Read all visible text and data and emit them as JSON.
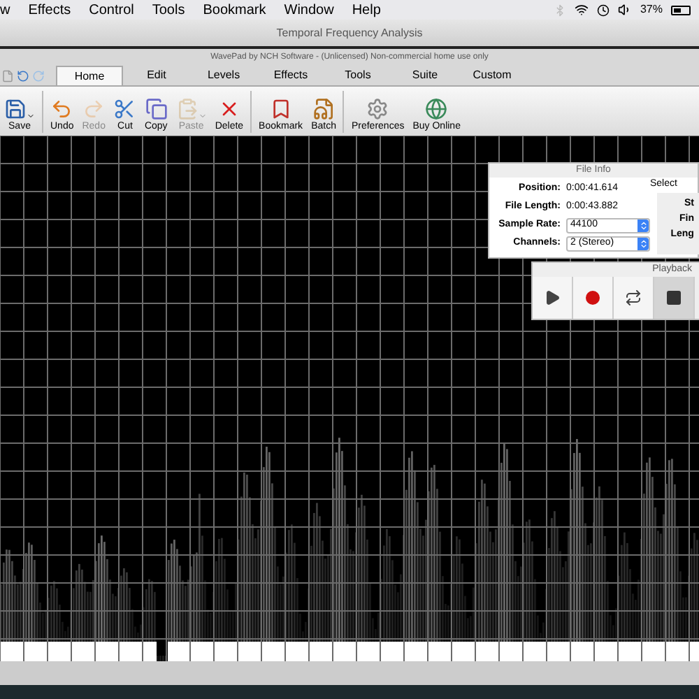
{
  "menu_bar": {
    "items": [
      "w",
      "Effects",
      "Control",
      "Tools",
      "Bookmark",
      "Window",
      "Help"
    ],
    "battery_text": "37%"
  },
  "window": {
    "title": "Temporal Frequency Analysis",
    "subtitle": "WavePad by NCH Software - (Unlicensed) Non-commercial home use only"
  },
  "tabs": [
    {
      "label": "Home",
      "selected": true
    },
    {
      "label": "Edit",
      "selected": false
    },
    {
      "label": "Levels",
      "selected": false
    },
    {
      "label": "Effects",
      "selected": false
    },
    {
      "label": "Tools",
      "selected": false
    },
    {
      "label": "Suite",
      "selected": false
    },
    {
      "label": "Custom",
      "selected": false
    }
  ],
  "toolbar": [
    {
      "kind": "save",
      "label": "Save",
      "disabled": false
    },
    {
      "kind": "undo",
      "label": "Undo",
      "disabled": false
    },
    {
      "kind": "redo",
      "label": "Redo",
      "disabled": true
    },
    {
      "kind": "cut",
      "label": "Cut",
      "disabled": false
    },
    {
      "kind": "copy",
      "label": "Copy",
      "disabled": false
    },
    {
      "kind": "paste",
      "label": "Paste",
      "disabled": true
    },
    {
      "kind": "delete",
      "label": "Delete",
      "disabled": false
    },
    {
      "kind": "bookmark",
      "label": "Bookmark",
      "disabled": false
    },
    {
      "kind": "batch",
      "label": "Batch",
      "disabled": false
    },
    {
      "kind": "preferences",
      "label": "Preferences",
      "disabled": false
    },
    {
      "kind": "buy",
      "label": "Buy Online",
      "disabled": false
    }
  ],
  "file_info": {
    "title": "File Info",
    "rows": [
      {
        "kind": "text",
        "label": "Position:",
        "value": "0:00:41.614"
      },
      {
        "kind": "text",
        "label": "File Length:",
        "value": "0:00:43.882"
      },
      {
        "kind": "select",
        "label": "Sample Rate:",
        "value": "44100"
      },
      {
        "kind": "select",
        "label": "Channels:",
        "value": "2 (Stereo)"
      }
    ],
    "selection": {
      "title": "Select",
      "labels": [
        "St",
        "Fin",
        "Leng"
      ]
    }
  },
  "playback": {
    "title": "Playback",
    "buttons": [
      {
        "kind": "play",
        "selected": false
      },
      {
        "kind": "record",
        "selected": false
      },
      {
        "kind": "loop",
        "selected": false
      },
      {
        "kind": "stop",
        "selected": true
      }
    ]
  }
}
